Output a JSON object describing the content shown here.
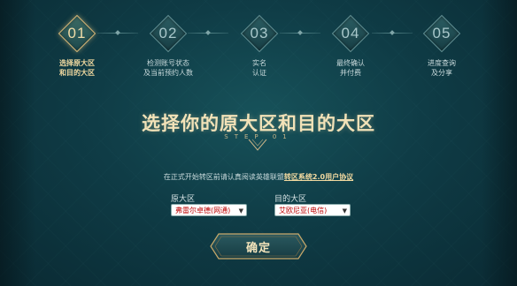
{
  "steps": [
    {
      "num": "01",
      "label_line1": "选择原大区",
      "label_line2": "和目的大区"
    },
    {
      "num": "02",
      "label_line1": "检测账号状态",
      "label_line2": "及当前预约人数"
    },
    {
      "num": "03",
      "label_line1": "实名",
      "label_line2": "认证"
    },
    {
      "num": "04",
      "label_line1": "最终确认",
      "label_line2": "并付费"
    },
    {
      "num": "05",
      "label_line1": "进度查询",
      "label_line2": "及分享"
    }
  ],
  "main": {
    "title": "选择你的原大区和目的大区",
    "subtitle": "STEP 01",
    "notice_prefix": "在正式开始转区前请认真阅读英雄联盟",
    "notice_link": "转区系统2.0用户协议",
    "source_label": "原大区",
    "source_value": "弗雷尔卓德(网通)",
    "target_label": "目的大区",
    "target_value": "艾欧尼亚(电信)",
    "confirm_label": "确定"
  },
  "colors": {
    "background": "#0f3c46",
    "accent_gold": "#f1d9a0",
    "select_text": "#bb0000"
  }
}
